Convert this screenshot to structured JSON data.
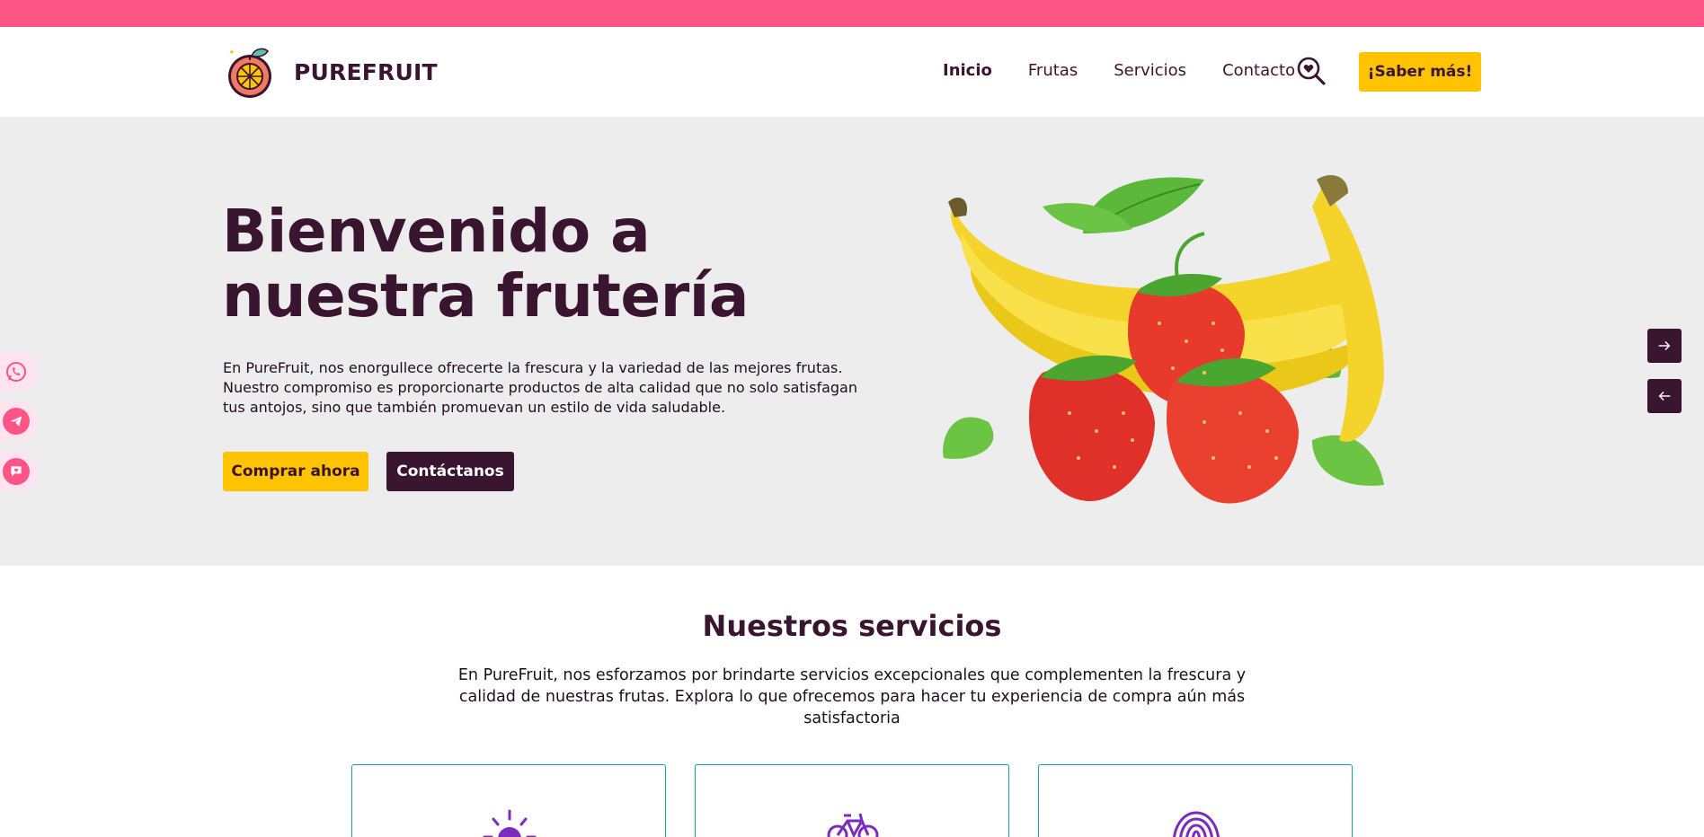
{
  "brand": {
    "name": "PUREFRUIT",
    "logo_icon": "orange-logo-icon"
  },
  "nav": {
    "items": [
      {
        "label": "Inicio",
        "active": true
      },
      {
        "label": "Frutas",
        "active": false
      },
      {
        "label": "Servicios",
        "active": false
      },
      {
        "label": "Contacto",
        "active": false
      }
    ],
    "search_icon": "search-heart-icon",
    "cta_label": "¡Saber más!"
  },
  "hero": {
    "title_line1": "Bienvenido a",
    "title_line2": "nuestra frutería",
    "description": "En PureFruit, nos enorgullece ofrecerte la frescura y la variedad de las mejores frutas. Nuestro compromiso es proporcionarte productos de alta calidad que no solo satisfagan tus antojos, sino que también promuevan un estilo de vida saludable.",
    "primary_button": "Comprar ahora",
    "secondary_button": "Contáctanos",
    "image": "bananas-strawberries-image"
  },
  "social": [
    "whatsapp-icon",
    "telegram-icon",
    "chat-heart-icon"
  ],
  "slider": {
    "next_icon": "arrow-right-icon",
    "prev_icon": "arrow-left-icon"
  },
  "services": {
    "title": "Nuestros servicios",
    "description": "En PureFruit, nos esforzamos por brindarte servicios excepcionales que complementen la frescura y calidad de nuestras frutas. Explora lo que ofrecemos para hacer tu experiencia de compra aún más satisfactoria",
    "cards": [
      {
        "icon": "sun-icon"
      },
      {
        "icon": "bicycle-icon"
      },
      {
        "icon": "fingerprint-icon"
      }
    ]
  },
  "colors": {
    "topbar": "#ff5486",
    "primary": "#ffc300",
    "dark": "#3a1530",
    "hero_bg": "#ededed",
    "card_border": "#1aa39a",
    "service_icon": "#7b2cbf"
  }
}
